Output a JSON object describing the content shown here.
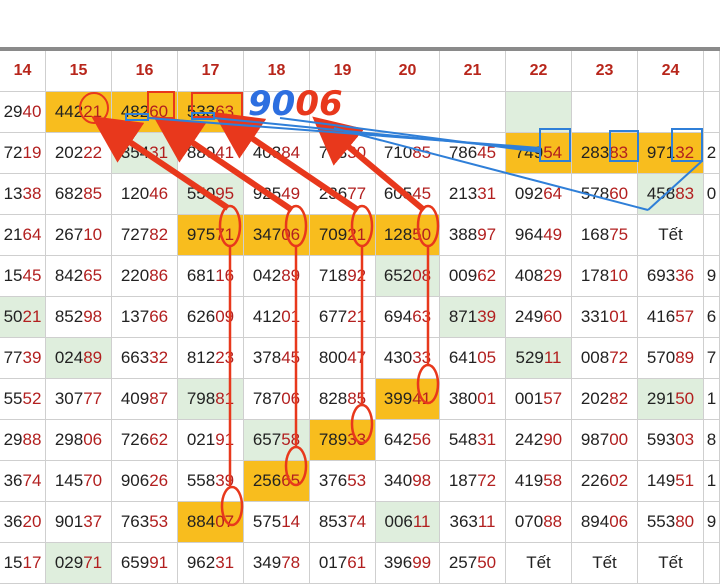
{
  "header_days": [
    "14",
    "15",
    "16",
    "17",
    "18",
    "19",
    "20",
    "21",
    "22",
    "23",
    "24"
  ],
  "rows": [
    [
      "2940",
      "44221",
      "48260",
      "53363",
      "",
      "",
      "",
      "",
      "",
      "",
      ""
    ],
    [
      "7219",
      "20222",
      "35431",
      "88041",
      "40384",
      "76330",
      "71085",
      "78645",
      "74954",
      "28383",
      "97132",
      "2"
    ],
    [
      "1338",
      "68285",
      "12046",
      "55095",
      "92549",
      "23677",
      "60545",
      "21331",
      "09264",
      "57860",
      "45883",
      "0"
    ],
    [
      "2164",
      "26710",
      "72782",
      "97571",
      "34706",
      "70921",
      "12850",
      "38897",
      "96449",
      "16875",
      "Tết"
    ],
    [
      "1545",
      "84265",
      "22086",
      "68116",
      "04289",
      "71892",
      "65208",
      "00962",
      "40829",
      "17810",
      "69336",
      "9"
    ],
    [
      "5021",
      "85298",
      "13766",
      "62609",
      "41201",
      "67721",
      "69463",
      "87139",
      "24960",
      "33101",
      "41657",
      "6"
    ],
    [
      "7739",
      "02489",
      "66332",
      "81223",
      "37845",
      "80047",
      "43033",
      "64105",
      "52911",
      "00872",
      "57089",
      "7"
    ],
    [
      "5552",
      "30777",
      "40987",
      "79881",
      "78706",
      "82885",
      "39941",
      "38001",
      "00157",
      "20282",
      "29150",
      "1"
    ],
    [
      "2988",
      "29806",
      "72662",
      "02191",
      "65758",
      "78933",
      "64256",
      "54831",
      "24290",
      "98700",
      "59303",
      "8"
    ],
    [
      "3674",
      "14570",
      "90626",
      "55839",
      "25665",
      "37653",
      "34098",
      "18772",
      "41958",
      "22602",
      "14951",
      "1"
    ],
    [
      "3620",
      "90137",
      "76353",
      "88407",
      "57514",
      "85374",
      "00611",
      "36311",
      "07088",
      "89406",
      "55380",
      "9"
    ],
    [
      "1517",
      "02971",
      "65991",
      "96231",
      "34978",
      "01761",
      "39699",
      "25750",
      "Tết",
      "Tết",
      "Tết"
    ]
  ],
  "annotation_text": "9006",
  "colors": {
    "header_text": "#b8261b",
    "last_digits": "#b21f1f",
    "highlight_orange": "#f8bd1e",
    "highlight_green": "#dfeedd",
    "arrow_red": "#e8381c",
    "box_blue": "#2f7fd8",
    "annotation_blue": "#2d6fe0",
    "annotation_red": "#e8381c"
  }
}
